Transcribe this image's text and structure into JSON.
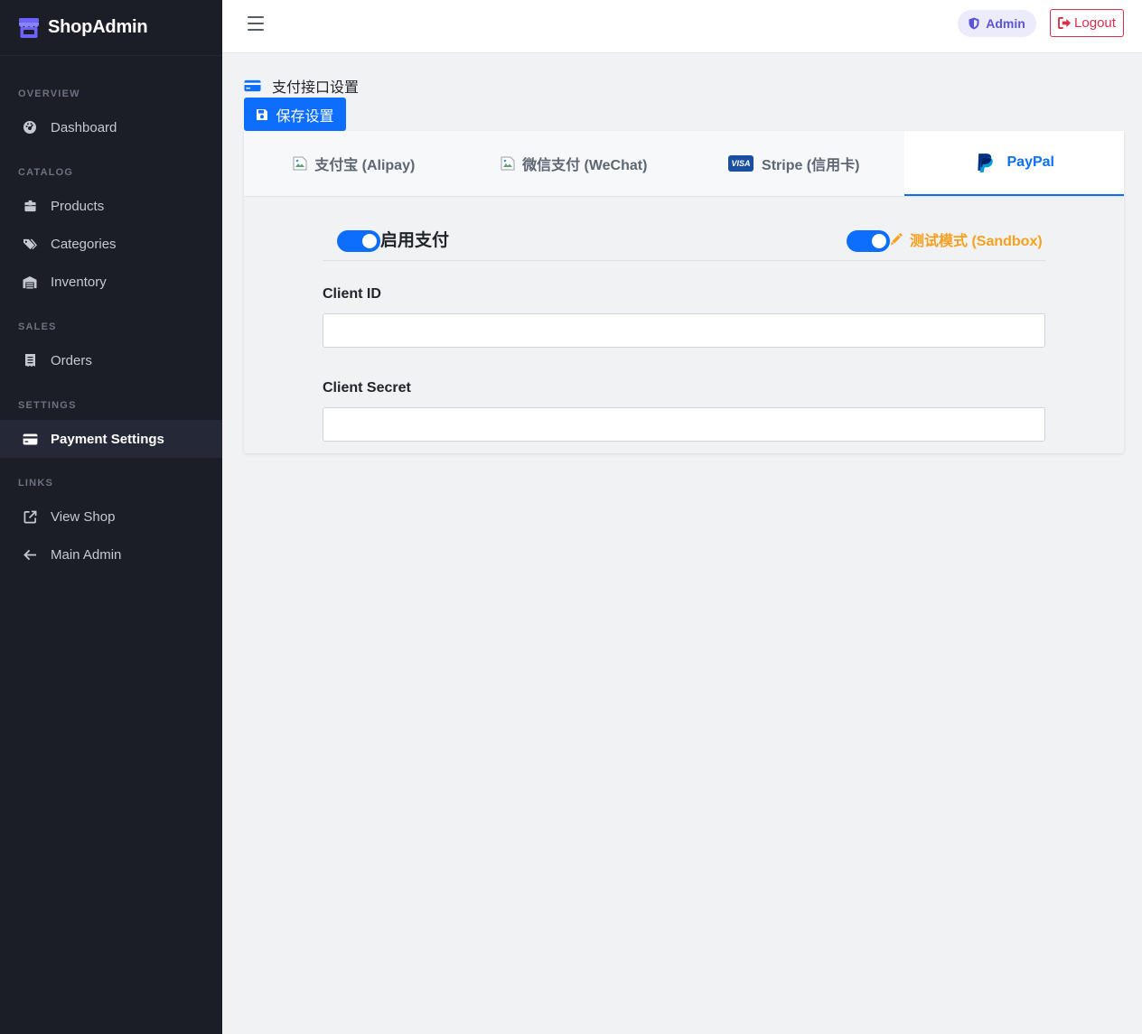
{
  "brand": {
    "name": "ShopAdmin"
  },
  "sidebar": {
    "sections": [
      {
        "title": "OVERVIEW",
        "items": [
          {
            "label": "Dashboard",
            "icon": "dashboard-icon"
          }
        ]
      },
      {
        "title": "CATALOG",
        "items": [
          {
            "label": "Products",
            "icon": "box-icon"
          },
          {
            "label": "Categories",
            "icon": "tags-icon"
          },
          {
            "label": "Inventory",
            "icon": "warehouse-icon"
          }
        ]
      },
      {
        "title": "SALES",
        "items": [
          {
            "label": "Orders",
            "icon": "receipt-icon"
          }
        ]
      },
      {
        "title": "SETTINGS",
        "items": [
          {
            "label": "Payment Settings",
            "icon": "credit-card-icon",
            "active": true
          }
        ]
      },
      {
        "title": "LINKS",
        "items": [
          {
            "label": "View Shop",
            "icon": "external-link-icon"
          },
          {
            "label": "Main Admin",
            "icon": "arrow-left-icon"
          }
        ]
      }
    ]
  },
  "topbar": {
    "admin_label": "Admin",
    "logout_label": "Logout"
  },
  "page": {
    "title": "支付接口设置",
    "save_label": "保存设置"
  },
  "tabs": [
    {
      "label": "支付宝 (Alipay)",
      "icon": "broken-image-icon"
    },
    {
      "label": "微信支付 (WeChat)",
      "icon": "broken-image-icon"
    },
    {
      "label": "Stripe (信用卡)",
      "icon": "visa-icon",
      "badge": "VISA"
    },
    {
      "label": "PayPal",
      "icon": "paypal-icon",
      "active": true
    }
  ],
  "paypal": {
    "enable_label": "启用支付",
    "sandbox_label": "测试模式 (Sandbox)",
    "client_id_label": "Client ID",
    "client_id_value": "",
    "client_secret_label": "Client Secret",
    "client_secret_value": ""
  },
  "colors": {
    "accent": "#0d6efd",
    "sidebar_bg": "#1b1e27",
    "brand_icon": "#6c63ff",
    "sandbox": "#f7a01d",
    "logout": "#d9304a",
    "admin_pill_bg": "#ecebfb",
    "admin_pill_text": "#5b54d6"
  }
}
